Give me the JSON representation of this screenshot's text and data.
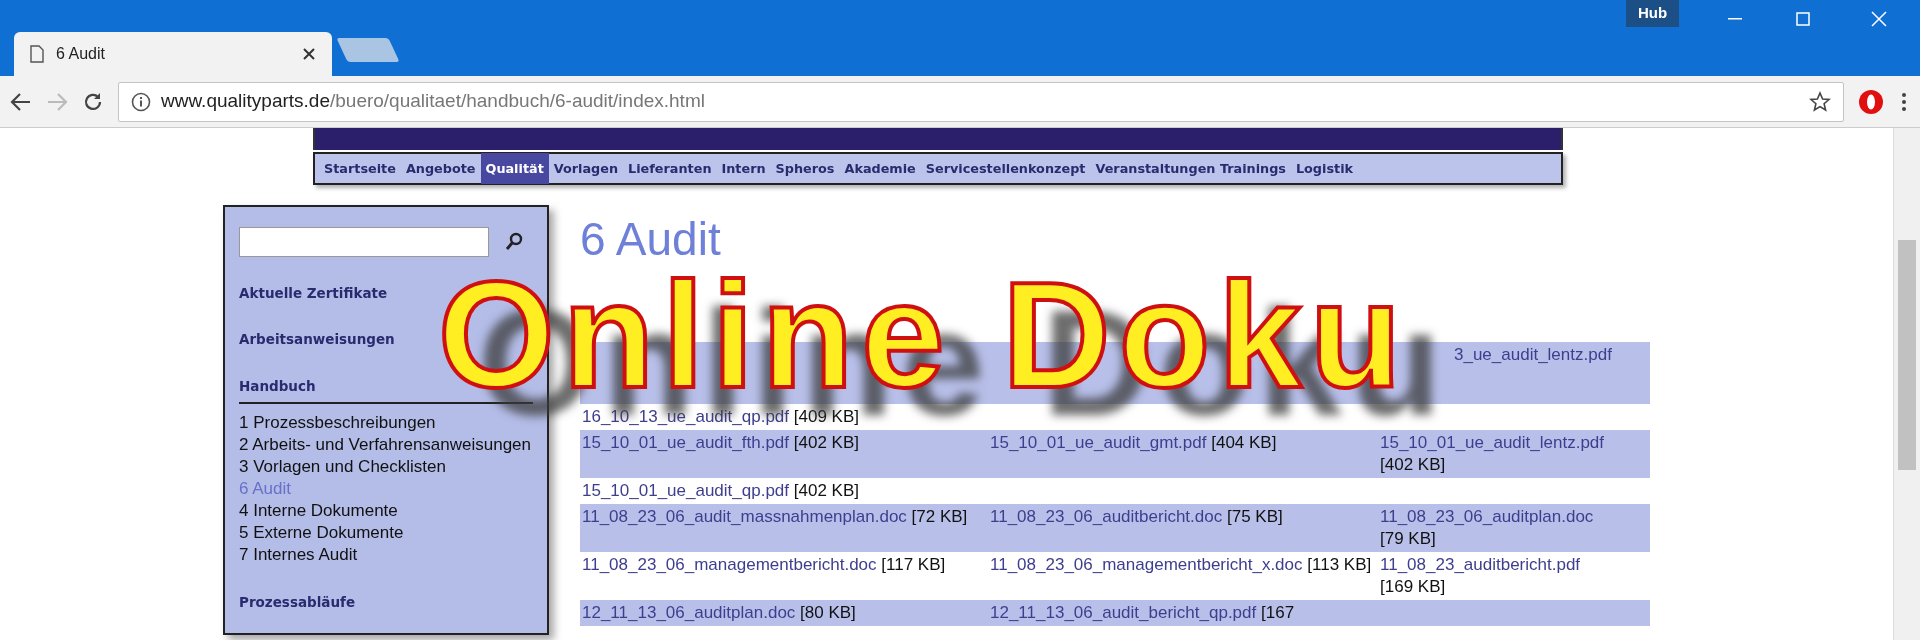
{
  "browser": {
    "tab_title": "6 Audit",
    "hub_label": "Hub",
    "address_host": "www.qualityparts.de",
    "address_path": "/buero/qualitaet/handbuch/6-audit/index.html"
  },
  "site_nav": [
    {
      "label": "Startseite",
      "selected": false
    },
    {
      "label": "Angebote",
      "selected": false
    },
    {
      "label": "Qualität",
      "selected": true
    },
    {
      "label": "Vorlagen",
      "selected": false
    },
    {
      "label": "Lieferanten",
      "selected": false
    },
    {
      "label": "Intern",
      "selected": false
    },
    {
      "label": "Spheros",
      "selected": false
    },
    {
      "label": "Akademie",
      "selected": false
    },
    {
      "label": "Servicestellenkonzept",
      "selected": false
    },
    {
      "label": "Veranstaltungen Trainings",
      "selected": false
    },
    {
      "label": "Logistik",
      "selected": false
    }
  ],
  "sidebar": {
    "sections": [
      {
        "title": "Aktuelle Zertifikate"
      },
      {
        "title": "Arbeitsanweisungen"
      },
      {
        "title": "Handbuch",
        "children": [
          {
            "label": "1 Prozessbeschreibungen",
            "selected": false
          },
          {
            "label": "2 Arbeits- und Verfahrensanweisungen",
            "selected": false
          },
          {
            "label": "3 Vorlagen und Checklisten",
            "selected": false
          },
          {
            "label": "6 Audit",
            "selected": true
          },
          {
            "label": "4 Interne Dokumente",
            "selected": false
          },
          {
            "label": "5 Externe Dokumente",
            "selected": false
          },
          {
            "label": "7 Internes Audit",
            "selected": false
          }
        ]
      },
      {
        "title": "Prozessabläufe"
      }
    ]
  },
  "content": {
    "heading": "6 Audit",
    "rows": [
      {
        "col_3": {
          "file": "3_ue_audit_lentz.pdf"
        }
      },
      {
        "col_1": {
          "file": "16_10_13_ue_audit_qp.pdf",
          "size": "[409 KB]"
        }
      },
      {
        "col_1": {
          "file": "15_10_01_ue_audit_fth.pdf",
          "size": "[402 KB]"
        },
        "col_2": {
          "file": "15_10_01_ue_audit_gmt.pdf",
          "size": "[404 KB]"
        },
        "col_3": {
          "file": "15_10_01_ue_audit_lentz.pdf",
          "size": "[402 KB]"
        }
      },
      {
        "col_1": {
          "file": "15_10_01_ue_audit_qp.pdf",
          "size": "[402 KB]"
        }
      },
      {
        "col_1": {
          "file": "11_08_23_06_audit_massnahmenplan.doc",
          "size": "[72 KB]"
        },
        "col_2": {
          "file": "11_08_23_06_auditbericht.doc",
          "size": "[75 KB]"
        },
        "col_3": {
          "file": "11_08_23_06_auditplan.doc",
          "size": "[79 KB]"
        }
      },
      {
        "col_1": {
          "file": "11_08_23_06_managementbericht.doc",
          "size": "[117 KB]"
        },
        "col_2": {
          "file": "11_08_23_06_managementbericht_x.doc",
          "size": "[113 KB]"
        },
        "col_3": {
          "file": "11_08_23_auditbericht.pdf",
          "size": "[169 KB]"
        }
      },
      {
        "col_1": {
          "file": "12_11_13_06_auditplan.doc",
          "size": "[80 KB]"
        },
        "col_2": {
          "file": "12_11_13_06_audit_bericht_qp.pdf",
          "size": "[167"
        }
      }
    ]
  },
  "overlay": {
    "title": "Online Doku"
  }
}
